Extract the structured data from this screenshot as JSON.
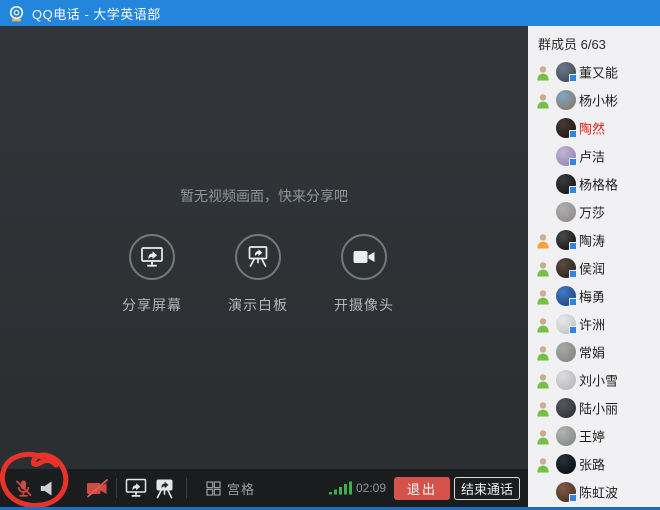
{
  "colors": {
    "titlebar": "#2386dc",
    "window_border": "#1a6fc0",
    "main_bg": "#2f3134",
    "toolbar_bg": "#1b1c1e",
    "sidebar_bg": "#f1f1f3",
    "muted_red": "#cf4a44",
    "exit_red": "#d4524a",
    "signal_green": "#3faf4a",
    "status_green": "#76c045",
    "status_orange": "#f2a33c",
    "highlight_name_red": "#e01f1f",
    "annotation_red": "#e8322a"
  },
  "window": {
    "title": "QQ电话 - 大学英语部"
  },
  "main": {
    "empty_message": "暂无视频画面，快来分享吧",
    "actions": [
      {
        "icon": "screen-share-icon",
        "label": "分享屏幕"
      },
      {
        "icon": "whiteboard-icon",
        "label": "演示白板"
      },
      {
        "icon": "camera-icon",
        "label": "开摄像头"
      }
    ]
  },
  "toolbar": {
    "mic_muted": true,
    "camera_muted": true,
    "grid_label": "宫格",
    "timer": "02:09",
    "exit_label": "退出",
    "end_call_label": "结束通话"
  },
  "annotation": {
    "type": "hand-drawn-red-circle",
    "target": "microphone-button"
  },
  "sidebar": {
    "header": "群成员 6/63",
    "members": [
      {
        "name": "董又能",
        "status": "green",
        "badge": true,
        "highlight": false,
        "avatar": [
          "#6a7688",
          "#39414e"
        ]
      },
      {
        "name": "杨小彬",
        "status": "green",
        "badge": false,
        "highlight": false,
        "avatar": [
          "#7fa7c9",
          "#8a6f52"
        ]
      },
      {
        "name": "陶然",
        "status": null,
        "badge": true,
        "highlight": true,
        "avatar": [
          "#4a3a34",
          "#16100d"
        ]
      },
      {
        "name": "卢洁",
        "status": null,
        "badge": true,
        "highlight": false,
        "avatar": [
          "#c3b3d6",
          "#8d7fae"
        ]
      },
      {
        "name": "杨格格",
        "status": null,
        "badge": true,
        "highlight": false,
        "avatar": [
          "#3a3a3e",
          "#101012"
        ]
      },
      {
        "name": "万莎",
        "status": null,
        "badge": false,
        "highlight": false,
        "avatar": [
          "#b0aeac",
          "#8a8886"
        ]
      },
      {
        "name": "陶涛",
        "status": "orange",
        "badge": true,
        "highlight": false,
        "avatar": [
          "#4a4a4a",
          "#0a0a0a"
        ]
      },
      {
        "name": "侯润",
        "status": "green",
        "badge": true,
        "highlight": false,
        "avatar": [
          "#5a4b42",
          "#241b16"
        ]
      },
      {
        "name": "梅勇",
        "status": "green",
        "badge": true,
        "highlight": false,
        "avatar": [
          "#4079c4",
          "#1c3e74"
        ]
      },
      {
        "name": "许洲",
        "status": "green",
        "badge": true,
        "highlight": false,
        "avatar": [
          "#e9e9eb",
          "#b9bcc0"
        ]
      },
      {
        "name": "常娟",
        "status": "green",
        "badge": false,
        "highlight": false,
        "avatar": [
          "#a8a8a6",
          "#7e7e7c"
        ]
      },
      {
        "name": "刘小雪",
        "status": "green",
        "badge": false,
        "highlight": false,
        "avatar": [
          "#dcdcde",
          "#aeb0b2"
        ]
      },
      {
        "name": "陆小丽",
        "status": "green",
        "badge": false,
        "highlight": false,
        "avatar": [
          "#55585f",
          "#26282e"
        ]
      },
      {
        "name": "王婷",
        "status": "green",
        "badge": false,
        "highlight": false,
        "avatar": [
          "#b3b5b2",
          "#7d807c"
        ]
      },
      {
        "name": "张路",
        "status": "green",
        "badge": false,
        "highlight": false,
        "avatar": [
          "#2a3038",
          "#05070a"
        ]
      },
      {
        "name": "陈虹波",
        "status": null,
        "badge": true,
        "highlight": false,
        "avatar": [
          "#7d5a45",
          "#3f2a1d"
        ]
      }
    ]
  }
}
